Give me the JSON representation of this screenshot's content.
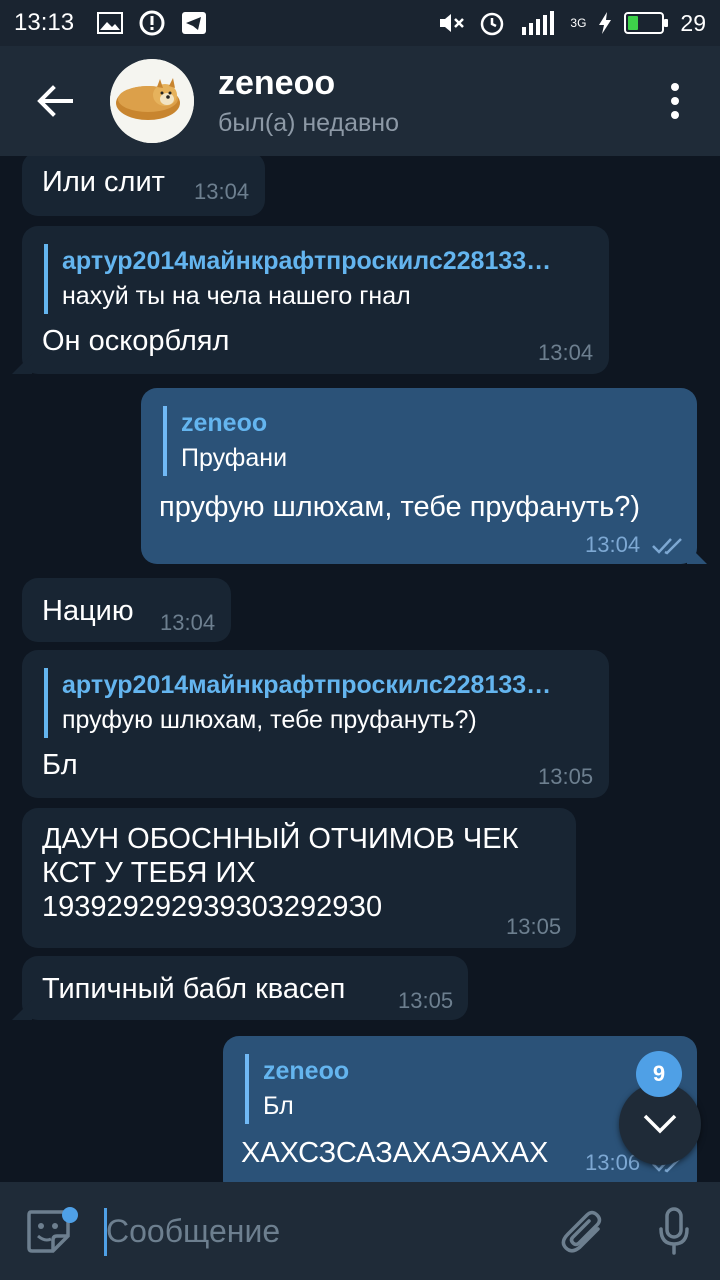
{
  "status_bar": {
    "time": "13:13",
    "network": "3G",
    "battery": "29",
    "battery_level": 0.29
  },
  "header": {
    "name": "zeneoo",
    "status": "был(а) недавно"
  },
  "messages": [
    {
      "dir": "in",
      "text": "Или слит",
      "time": "13:04"
    },
    {
      "dir": "in",
      "reply_name": "артур2014майнкрафтпроскилс228133…",
      "reply_text": "нахуй ты на чела нашего гнал",
      "text": "Он оскорблял",
      "time": "13:04"
    },
    {
      "dir": "out",
      "reply_name": "zeneoo",
      "reply_text": "Пруфани",
      "text": "пруфую шлюхам, тебе пруфануть?)",
      "time": "13:04"
    },
    {
      "dir": "in",
      "text": "Нацию",
      "time": "13:04"
    },
    {
      "dir": "in",
      "reply_name": "артур2014майнкрафтпроскилс228133…",
      "reply_text": "пруфую шлюхам, тебе пруфануть?)",
      "text": "Бл",
      "time": "13:05"
    },
    {
      "dir": "in",
      "text_lines": [
        "ДАУН ОБОСННЫЙ ОТЧИМОВ ЧЕК",
        "КСТ У ТЕБЯ ИХ",
        "1939292929393032929З0"
      ],
      "time": "13:05"
    },
    {
      "dir": "in",
      "text": "Типичный бабл квасеп",
      "time": "13:05"
    },
    {
      "dir": "out",
      "reply_name": "zeneoo",
      "reply_text": "Бл",
      "text": "ХАХСЗСАЗАХАЭАХАХ",
      "time": "13:06"
    }
  ],
  "scroll": {
    "unread_count": "9"
  },
  "composer": {
    "placeholder": "Сообщение"
  },
  "colors": {
    "background": "#0e1621",
    "incoming_bubble": "#182533",
    "outgoing_bubble": "#2b5278",
    "accent": "#4fa0e6"
  },
  "icons": [
    "image-icon",
    "alert-icon",
    "telegram-icon",
    "mute-icon",
    "alarm-icon",
    "signal-icon",
    "charging-icon",
    "back-arrow-icon",
    "more-vert-icon",
    "double-check-icon",
    "chevron-down-icon",
    "sticker-icon",
    "paperclip-icon",
    "microphone-icon"
  ]
}
